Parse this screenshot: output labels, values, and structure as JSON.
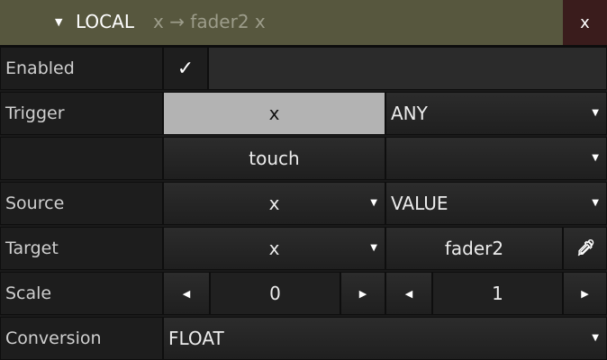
{
  "header": {
    "title": "LOCAL",
    "subtitle": "x → fader2 x",
    "collapse_glyph": "▼",
    "close_label": "x",
    "colors": {
      "header_bg": "#57573e",
      "close_bg": "#3a1c1c",
      "subtitle": "#9c9c8a"
    }
  },
  "rows": {
    "enabled": {
      "label": "Enabled",
      "checkbox_glyph": "✓",
      "checked": true
    },
    "trigger": {
      "label": "Trigger",
      "button": "x",
      "select": "ANY"
    },
    "trigger2": {
      "label": "",
      "select_left": "touch",
      "select_right": ""
    },
    "source": {
      "label": "Source",
      "select_left": "x",
      "select_right": "VALUE"
    },
    "target": {
      "label": "Target",
      "select_left": "x",
      "button": "fader2",
      "picker_icon": "eyedropper-icon"
    },
    "scale": {
      "label": "Scale",
      "left_dec": "◀",
      "left_value": "0",
      "left_inc": "▶",
      "right_dec": "◀",
      "right_value": "1",
      "right_inc": "▶"
    },
    "conversion": {
      "label": "Conversion",
      "select": "FLOAT"
    }
  },
  "caret_glyph": "▼",
  "colors": {
    "pressed_button": "#b3b3b3",
    "cell_bg": "#262626",
    "label_bg": "#1d1d1d"
  }
}
